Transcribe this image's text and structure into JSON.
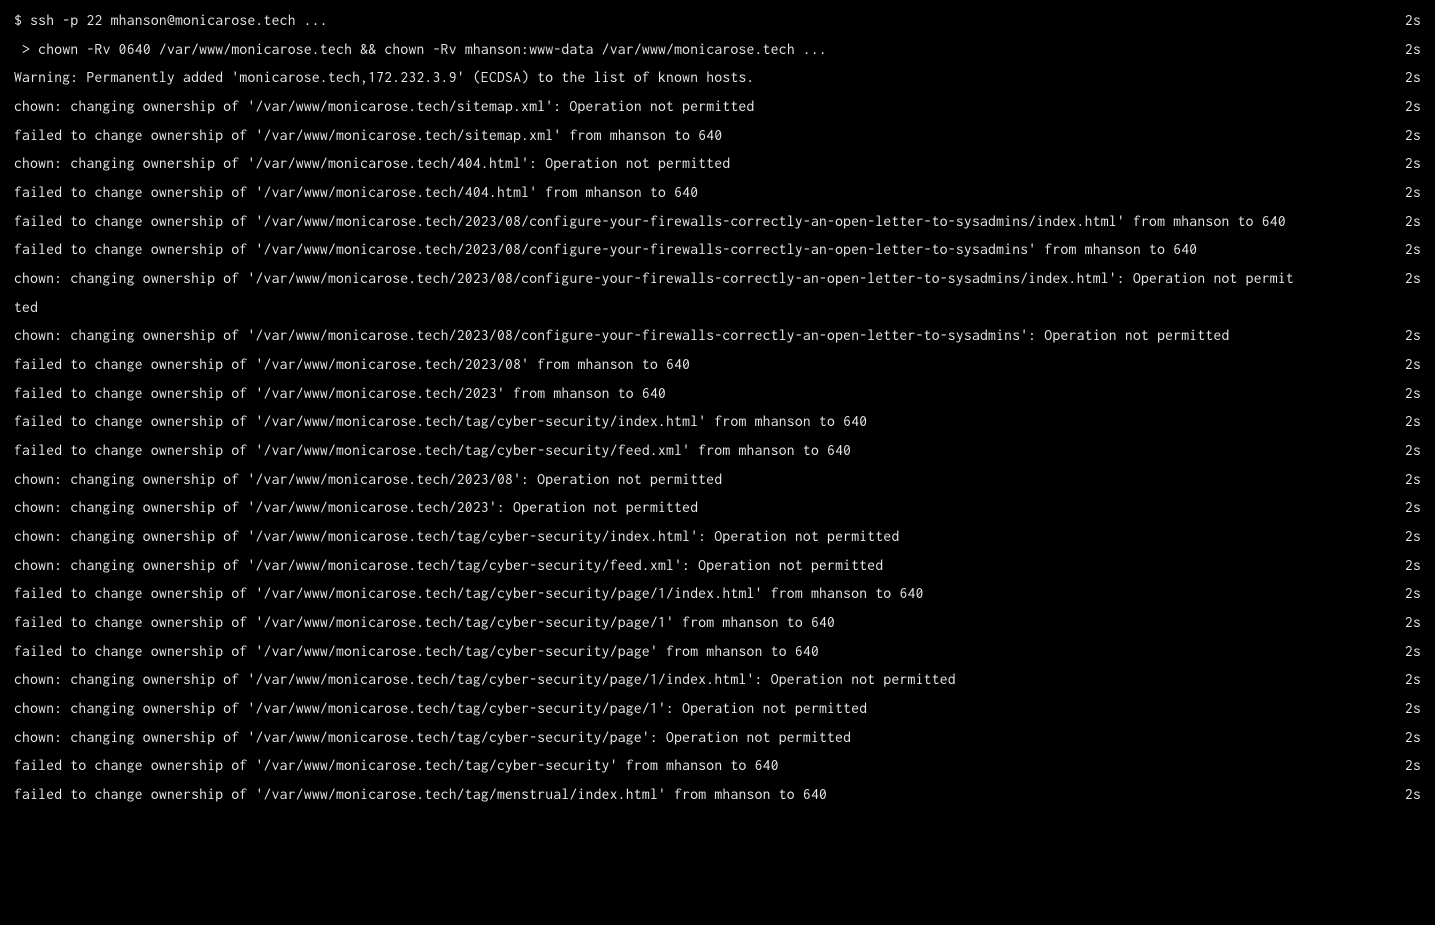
{
  "lines": [
    {
      "text": "$ ssh -p 22 mhanson@monicarose.tech ...",
      "time": "2s"
    },
    {
      "text": " > chown -Rv 0640 /var/www/monicarose.tech && chown -Rv mhanson:www-data /var/www/monicarose.tech ...",
      "time": "2s"
    },
    {
      "text": "Warning: Permanently added 'monicarose.tech,172.232.3.9' (ECDSA) to the list of known hosts.",
      "time": "2s"
    },
    {
      "text": "chown: changing ownership of '/var/www/monicarose.tech/sitemap.xml': Operation not permitted",
      "time": "2s"
    },
    {
      "text": "failed to change ownership of '/var/www/monicarose.tech/sitemap.xml' from mhanson to 640",
      "time": "2s"
    },
    {
      "text": "chown: changing ownership of '/var/www/monicarose.tech/404.html': Operation not permitted",
      "time": "2s"
    },
    {
      "text": "failed to change ownership of '/var/www/monicarose.tech/404.html' from mhanson to 640",
      "time": "2s"
    },
    {
      "text": "failed to change ownership of '/var/www/monicarose.tech/2023/08/configure-your-firewalls-correctly-an-open-letter-to-sysadmins/index.html' from mhanson to 640",
      "time": "2s"
    },
    {
      "text": "failed to change ownership of '/var/www/monicarose.tech/2023/08/configure-your-firewalls-correctly-an-open-letter-to-sysadmins' from mhanson to 640",
      "time": "2s"
    },
    {
      "text": "chown: changing ownership of '/var/www/monicarose.tech/2023/08/configure-your-firewalls-correctly-an-open-letter-to-sysadmins/index.html': Operation not permitted",
      "time": "2s"
    },
    {
      "text": "chown: changing ownership of '/var/www/monicarose.tech/2023/08/configure-your-firewalls-correctly-an-open-letter-to-sysadmins': Operation not permitted",
      "time": "2s"
    },
    {
      "text": "failed to change ownership of '/var/www/monicarose.tech/2023/08' from mhanson to 640",
      "time": "2s"
    },
    {
      "text": "failed to change ownership of '/var/www/monicarose.tech/2023' from mhanson to 640",
      "time": "2s"
    },
    {
      "text": "failed to change ownership of '/var/www/monicarose.tech/tag/cyber-security/index.html' from mhanson to 640",
      "time": "2s"
    },
    {
      "text": "failed to change ownership of '/var/www/monicarose.tech/tag/cyber-security/feed.xml' from mhanson to 640",
      "time": "2s"
    },
    {
      "text": "chown: changing ownership of '/var/www/monicarose.tech/2023/08': Operation not permitted",
      "time": "2s"
    },
    {
      "text": "chown: changing ownership of '/var/www/monicarose.tech/2023': Operation not permitted",
      "time": "2s"
    },
    {
      "text": "chown: changing ownership of '/var/www/monicarose.tech/tag/cyber-security/index.html': Operation not permitted",
      "time": "2s"
    },
    {
      "text": "chown: changing ownership of '/var/www/monicarose.tech/tag/cyber-security/feed.xml': Operation not permitted",
      "time": "2s"
    },
    {
      "text": "failed to change ownership of '/var/www/monicarose.tech/tag/cyber-security/page/1/index.html' from mhanson to 640",
      "time": "2s"
    },
    {
      "text": "failed to change ownership of '/var/www/monicarose.tech/tag/cyber-security/page/1' from mhanson to 640",
      "time": "2s"
    },
    {
      "text": "failed to change ownership of '/var/www/monicarose.tech/tag/cyber-security/page' from mhanson to 640",
      "time": "2s"
    },
    {
      "text": "chown: changing ownership of '/var/www/monicarose.tech/tag/cyber-security/page/1/index.html': Operation not permitted",
      "time": "2s"
    },
    {
      "text": "chown: changing ownership of '/var/www/monicarose.tech/tag/cyber-security/page/1': Operation not permitted",
      "time": "2s"
    },
    {
      "text": "chown: changing ownership of '/var/www/monicarose.tech/tag/cyber-security/page': Operation not permitted",
      "time": "2s"
    },
    {
      "text": "failed to change ownership of '/var/www/monicarose.tech/tag/cyber-security' from mhanson to 640",
      "time": "2s"
    },
    {
      "text": "failed to change ownership of '/var/www/monicarose.tech/tag/menstrual/index.html' from mhanson to 640",
      "time": "2s"
    }
  ]
}
